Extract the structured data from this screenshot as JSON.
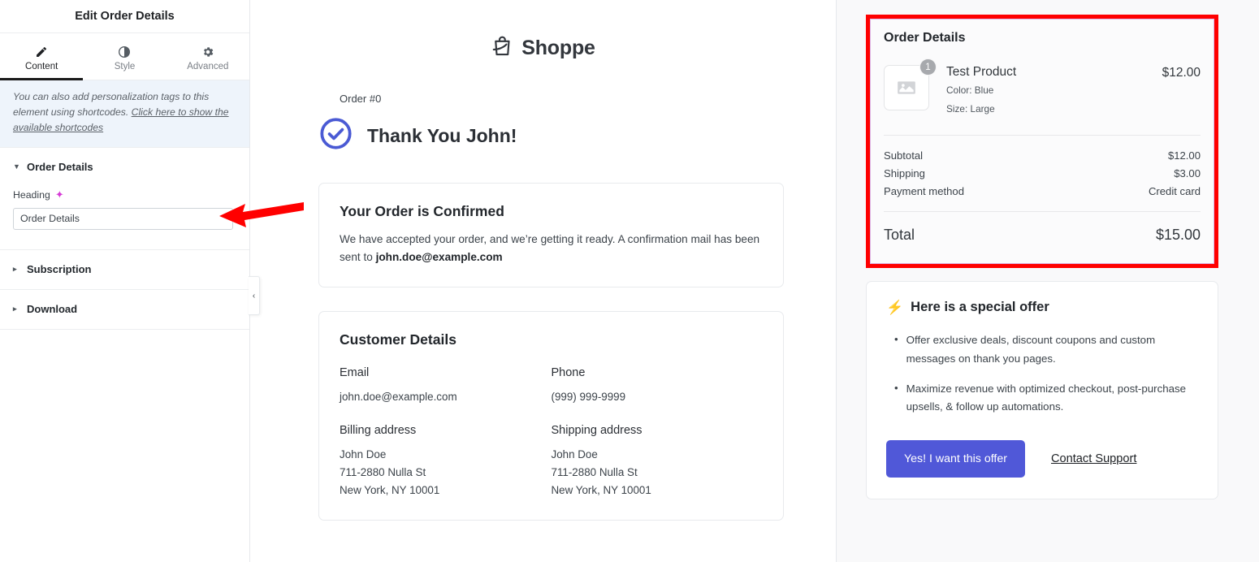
{
  "sidebar": {
    "title": "Edit Order Details",
    "tabs": [
      {
        "label": "Content",
        "icon": "pencil-icon",
        "active": true
      },
      {
        "label": "Style",
        "icon": "contrast-icon",
        "active": false
      },
      {
        "label": "Advanced",
        "icon": "gear-icon",
        "active": false
      }
    ],
    "notice": {
      "text": "You can also add personalization tags to this element using shortcodes. ",
      "link": "Click here to show the available shortcodes"
    },
    "sections": [
      {
        "label": "Order Details",
        "expanded": true,
        "caret": "▼"
      },
      {
        "label": "Subscription",
        "expanded": false,
        "caret": "▸"
      },
      {
        "label": "Download",
        "expanded": false,
        "caret": "▸"
      }
    ],
    "heading_field": {
      "label": "Heading",
      "ai_icon": "sparkle-icon",
      "value": "Order Details",
      "placeholder": "Order Details"
    },
    "collapse_handle": "‹"
  },
  "preview": {
    "brand": "Shoppe",
    "brand_icon": "shopping-bag-icon",
    "order_number": "Order #0",
    "thank_you": "Thank You John!",
    "check_icon": "check-circle-icon",
    "confirmed": {
      "title": "Your Order is Confirmed",
      "body_lead": "We have accepted your order, and we’re getting it ready. A confirmation mail has been sent to ",
      "body_email": "john.doe@example.com"
    },
    "customer": {
      "title": "Customer Details",
      "email_label": "Email",
      "email_value": "john.doe@example.com",
      "phone_label": "Phone",
      "phone_value": "(999) 999-9999",
      "billing_label": "Billing address",
      "billing_value": "John Doe\n711-2880 Nulla St\nNew York, NY 10001",
      "shipping_label": "Shipping address",
      "shipping_value": "John Doe\n711-2880 Nulla St\nNew York, NY 10001"
    }
  },
  "order_details": {
    "title": "Order Details",
    "selection_color": "#ff0000",
    "item": {
      "name": "Test Product",
      "price": "$12.00",
      "quantity": "1",
      "thumb_icon": "image-placeholder-icon",
      "attr_color": "Color: Blue",
      "attr_size": "Size: Large"
    },
    "totals": [
      {
        "label": "Subtotal",
        "value": "$12.00"
      },
      {
        "label": "Shipping",
        "value": "$3.00"
      },
      {
        "label": "Payment method",
        "value": "Credit card"
      }
    ],
    "grand_total_label": "Total",
    "grand_total_value": "$15.00"
  },
  "offer": {
    "icon": "lightning-bolt-icon",
    "title": "Here is a special offer",
    "bullets": [
      "Offer exclusive deals, discount coupons and custom messages on thank you pages.",
      "Maximize revenue with optimized checkout, post-purchase upsells, & follow up automations."
    ],
    "cta_label": "Yes! I want this offer",
    "cta_color": "#5058d8",
    "support_label": "Contact Support"
  },
  "annotation": {
    "arrow": "left-pointing-red-arrow",
    "color": "#ff0000"
  }
}
